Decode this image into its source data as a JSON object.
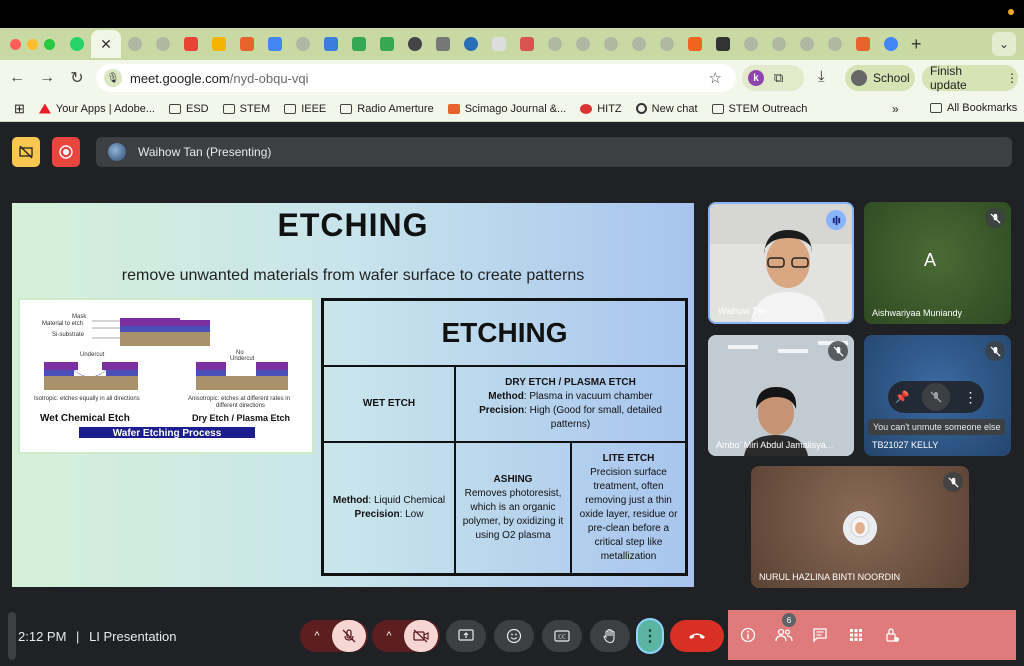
{
  "browser": {
    "url_host": "meet.google.com",
    "url_path": "/nyd-obqu-vqi",
    "profile_label": "School",
    "update_label": "Finish update"
  },
  "bookmarks": [
    {
      "label": "Your Apps | Adobe...",
      "icon": "adobe-icon"
    },
    {
      "label": "ESD",
      "icon": "folder-icon"
    },
    {
      "label": "STEM",
      "icon": "folder-icon"
    },
    {
      "label": "IEEE",
      "icon": "folder-icon"
    },
    {
      "label": "Radio Amerture",
      "icon": "folder-icon"
    },
    {
      "label": "Scimago Journal &...",
      "icon": "sjr-icon"
    },
    {
      "label": "HITZ",
      "icon": "hitz-icon"
    },
    {
      "label": "New chat",
      "icon": "chat-icon"
    },
    {
      "label": "STEM Outreach",
      "icon": "folder-icon"
    }
  ],
  "all_bookmarks_label": "All Bookmarks",
  "meet": {
    "presenting_label": "Waihow Tan (Presenting)",
    "time": "2:12 PM",
    "separator": "|",
    "meeting_name": "LI Presentation",
    "participant_count": "6",
    "unmute_tooltip": "You can't unmute someone else"
  },
  "slide": {
    "title": "ETCHING",
    "subtitle": "remove unwanted materials from wafer surface to create patterns",
    "diagram": {
      "mask": "Mask",
      "material": "Material to etch",
      "substrate": "Si-substrate",
      "undercut": "Undercut",
      "no_undercut_1": "No",
      "no_undercut_2": "Undercut",
      "isotropic": "Isotropic: etches equally in all directions",
      "anisotropic_1": "Anisotropic: etches at different rates in",
      "anisotropic_2": "different directions",
      "wet_label": "Wet Chemical Etch",
      "dry_label": "Dry Etch / Plasma Etch",
      "process_label": "Wafer Etching Process"
    },
    "table": {
      "header": "ETCHING",
      "wet_etch": "WET ETCH",
      "dry_etch_title": "DRY ETCH / PLASMA ETCH",
      "dry_method_key": "Method",
      "dry_method_val": ": Plasma in vacuum chamber",
      "dry_precision_key": "Precision",
      "dry_precision_val": ": High (Good for small, detailed patterns)",
      "wet_method_key": "Method",
      "wet_method_val": ": Liquid Chemical",
      "wet_precision_key": "Precision",
      "wet_precision_val": ": Low",
      "ashing_title": "ASHING",
      "ashing_desc": "Removes photoresist, which is an organic polymer, by oxidizing it using O2 plasma",
      "lite_title": "LITE ETCH",
      "lite_desc": "Precision surface treatment, often removing just a thin oxide layer, residue or pre-clean before a critical step like metallization"
    }
  },
  "participants": [
    {
      "name": "Waihow Tan",
      "initial": ""
    },
    {
      "name": "Aishwariyaa Muniandy",
      "initial": "A"
    },
    {
      "name": "Ambo' Miri Abdul Jamalisya...",
      "initial": ""
    },
    {
      "name": "TB21027 KELLY",
      "initial": ""
    },
    {
      "name": "NURUL HAZLINA BINTI NOORDIN",
      "initial": ""
    }
  ],
  "colors": {
    "meet_bg": "#202124",
    "end_call": "#d93025",
    "active_more": "#5bb5a2",
    "host_panel": "#e07b7b"
  }
}
